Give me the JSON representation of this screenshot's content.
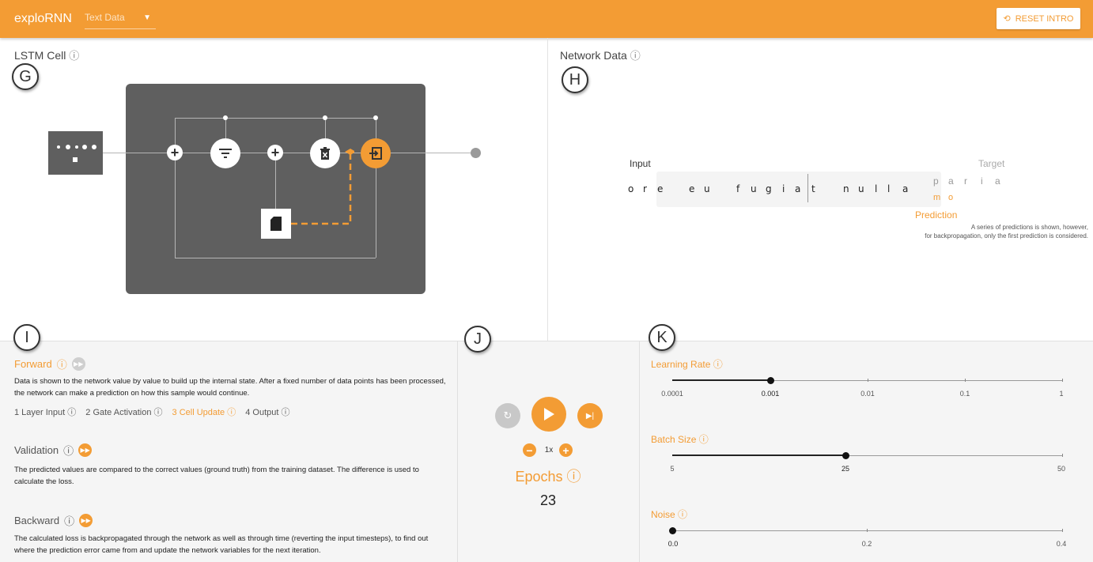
{
  "header": {
    "app_title": "exploRNN",
    "dataset_select": "Text Data",
    "reset_button": "RESET INTRO"
  },
  "lstm": {
    "title": "LSTM Cell",
    "marker": "G"
  },
  "network_data": {
    "title": "Network Data",
    "marker": "H",
    "input_label": "Input",
    "target_label": "Target",
    "input_chars": [
      "o",
      "r",
      "e",
      "e",
      "u",
      "f",
      "u",
      "g",
      "i",
      "a",
      "t",
      "n",
      "u",
      "l",
      "l",
      "a"
    ],
    "target_chars": [
      "p",
      "a",
      "r",
      "i",
      "a"
    ],
    "prediction_chars": [
      "m",
      "o"
    ],
    "prediction_label": "Prediction",
    "prediction_note_line1": "A series of predictions is shown, however,",
    "prediction_note_line2": "for backpropagation, only the first prediction is considered."
  },
  "training": {
    "marker": "I",
    "forward": {
      "title": "Forward",
      "description": "Data is shown to the network value by value to build up the internal state. After a fixed number of data points has been processed, the network can make a prediction on how this sample would continue.",
      "steps": [
        {
          "label": "1 Layer Input",
          "active": false
        },
        {
          "label": "2 Gate Activation",
          "active": false
        },
        {
          "label": "3 Cell Update",
          "active": true
        },
        {
          "label": "4 Output",
          "active": false
        }
      ]
    },
    "validation": {
      "title": "Validation",
      "description": "The predicted values are compared to the correct values (ground truth) from the training dataset. The difference is used to calculate the loss."
    },
    "backward": {
      "title": "Backward",
      "description": "The calculated loss is backpropagated through the network as well as through time (reverting the input timesteps), to find out where the prediction error came from and update the network variables for the next iteration."
    }
  },
  "controls": {
    "marker": "J",
    "speed": "1x",
    "epochs_label": "Epochs",
    "epochs_value": "23"
  },
  "params": {
    "marker": "K",
    "learning_rate": {
      "title": "Learning Rate",
      "ticks": [
        "0.0001",
        "0.001",
        "0.01",
        "0.1",
        "1"
      ],
      "value": "0.001"
    },
    "batch_size": {
      "title": "Batch Size",
      "ticks": [
        "5",
        "25",
        "50"
      ],
      "value": 25
    },
    "noise": {
      "title": "Noise",
      "ticks": [
        "0.0",
        "0.2",
        "0.4"
      ],
      "value": 0.0
    }
  },
  "info_glyph": "ⓘ",
  "colors": {
    "accent": "#f39c34",
    "cell_bg": "#5f5f5f"
  }
}
